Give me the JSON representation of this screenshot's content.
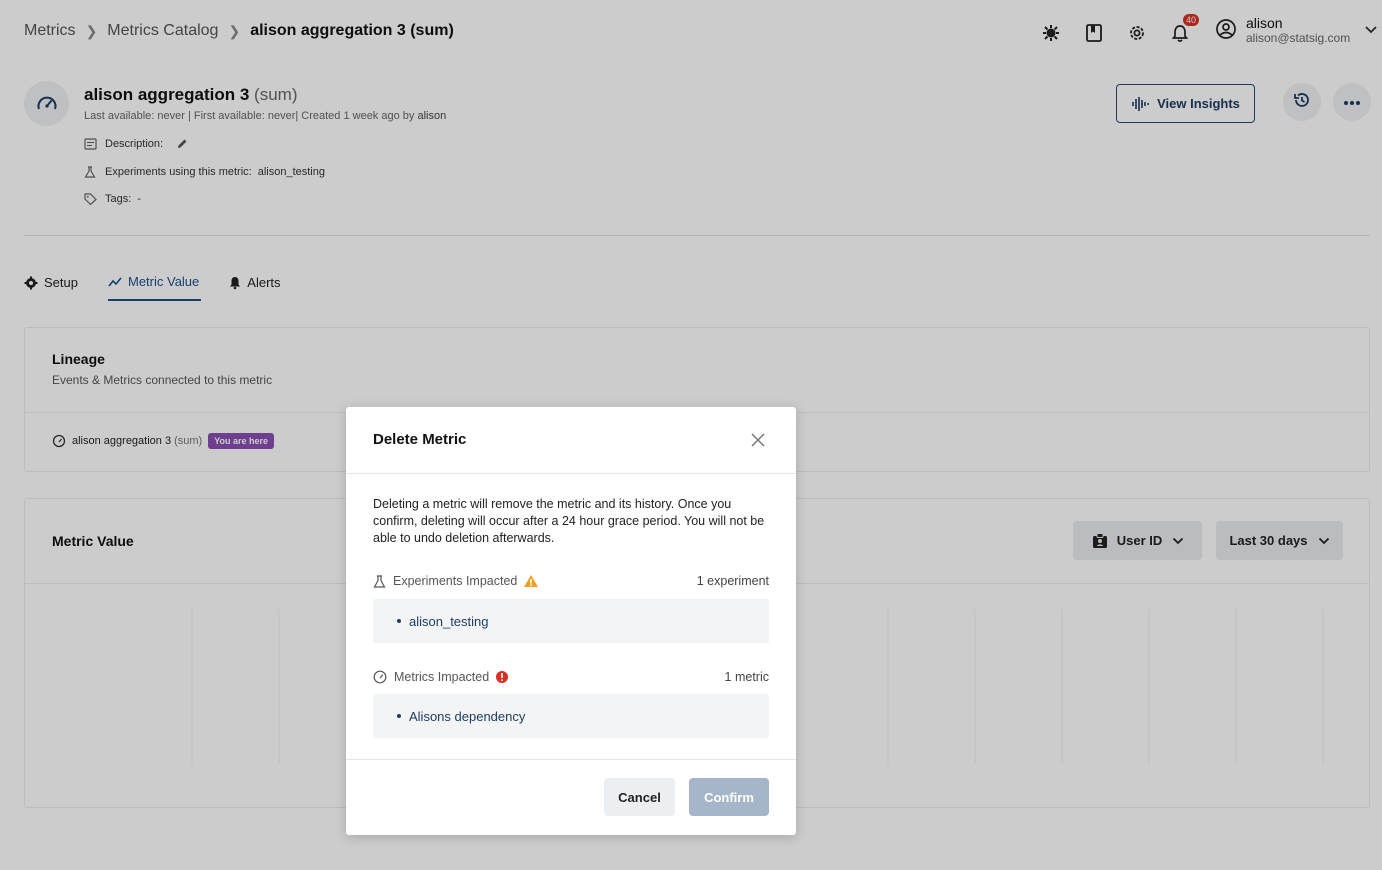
{
  "breadcrumb": {
    "items": [
      "Metrics",
      "Metrics Catalog"
    ],
    "current": "alison aggregation 3 (sum)"
  },
  "topbar": {
    "icons": [
      "bug-icon",
      "book-icon",
      "gear-icon",
      "bell-icon"
    ],
    "notification_count": "40",
    "user": {
      "name": "alison",
      "email": "alison@statsig.com"
    }
  },
  "metric": {
    "name": "alison aggregation 3",
    "aggregation": "(sum)",
    "availability": "Last available: never | First available: never| Created 1 week ago by",
    "created_by": "alison",
    "description_label": "Description:",
    "experiments_label": "Experiments using this metric:",
    "experiments_value": "alison_testing",
    "tags_label": "Tags:",
    "tags_value": "-"
  },
  "header_actions": {
    "view_insights": "View Insights"
  },
  "tabs": [
    {
      "label": "Setup",
      "icon": "gear-icon"
    },
    {
      "label": "Metric Value",
      "icon": "trend-icon",
      "active": true
    },
    {
      "label": "Alerts",
      "icon": "bell-icon"
    }
  ],
  "lineage": {
    "title": "Lineage",
    "subtitle": "Events & Metrics connected to this metric",
    "node_name": "alison aggregation 3",
    "node_agg": "(sum)",
    "node_pill": "You are here"
  },
  "metric_value": {
    "title": "Metric Value",
    "unit_dropdown": "User ID",
    "range_dropdown": "Last 30 days"
  },
  "modal": {
    "title": "Delete Metric",
    "body": "Deleting a metric will remove the metric and its history. Once you confirm, deleting will occur after a 24 hour grace period. You will not be able to undo deletion afterwards.",
    "experiments": {
      "label": "Experiments Impacted",
      "count": "1 experiment",
      "items": [
        "alison_testing"
      ]
    },
    "metrics": {
      "label": "Metrics Impacted",
      "count": "1 metric",
      "items": [
        "Alisons dependency"
      ]
    },
    "cancel": "Cancel",
    "confirm": "Confirm"
  },
  "colors": {
    "accent": "#1f3d62",
    "pill": "#8a4fb2",
    "warning": "#f0a020",
    "error": "#d93025",
    "confirm_disabled": "#a6b6ca"
  }
}
